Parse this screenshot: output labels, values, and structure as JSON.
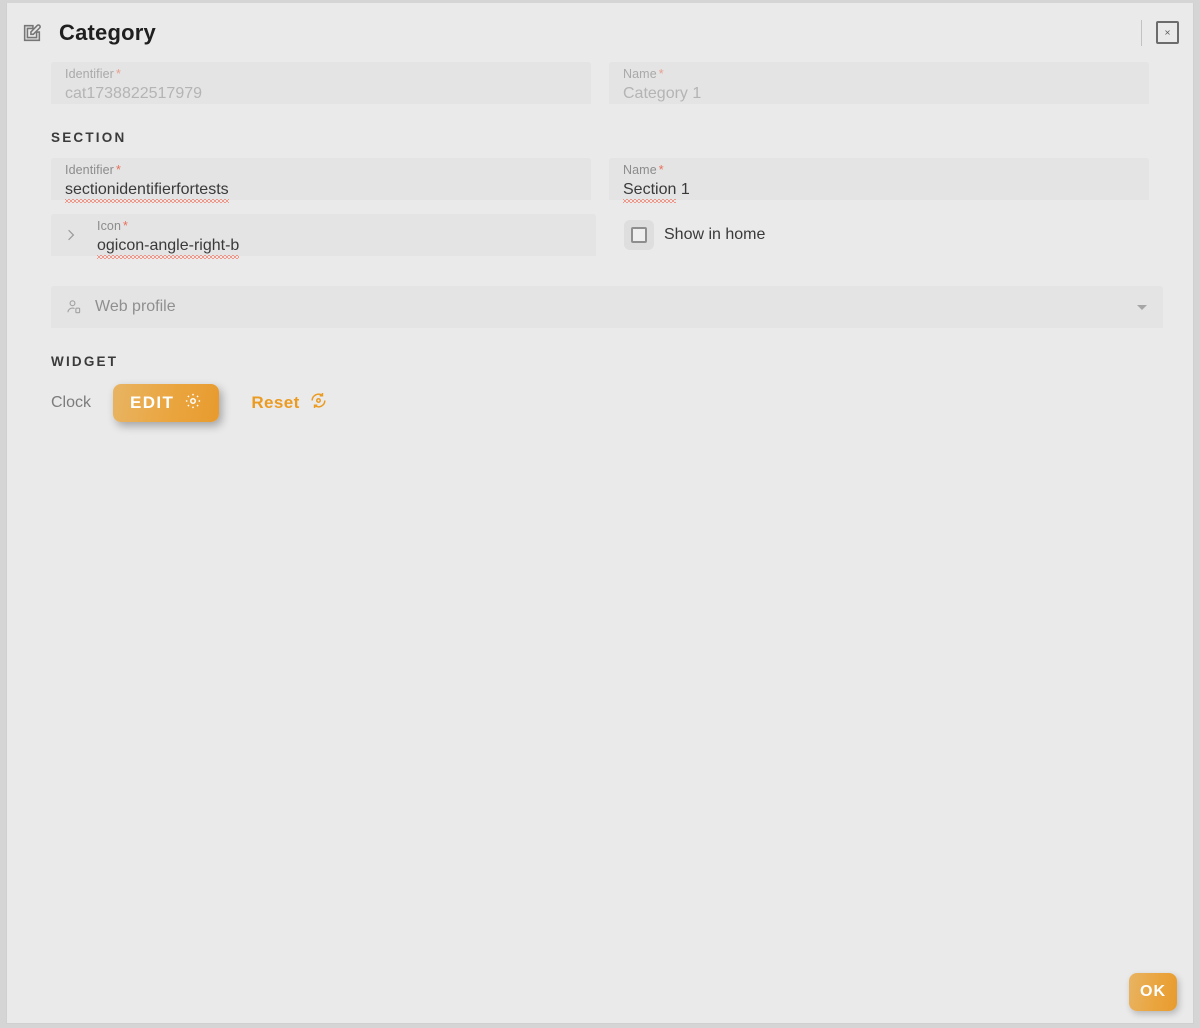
{
  "dialog": {
    "title": "Category",
    "header_icon": "edit-square-icon",
    "close_label": "×"
  },
  "category": {
    "identifier": {
      "label": "Identifier",
      "required_mark": "*",
      "value": "cat1738822517979",
      "enabled": false
    },
    "name": {
      "label": "Name",
      "required_mark": "*",
      "value": "Category 1",
      "enabled": false
    }
  },
  "section": {
    "heading": "SECTION",
    "identifier": {
      "label": "Identifier",
      "required_mark": "*",
      "value": "sectionidentifierfortests",
      "enabled": true
    },
    "name": {
      "label": "Name",
      "required_mark": "*",
      "value_misspelled": "Section",
      "value_rest": " 1",
      "enabled": true
    },
    "icon": {
      "label": "Icon",
      "required_mark": "*",
      "value": "ogicon-angle-right-b",
      "prefix_icon": "chevron-right-icon"
    },
    "show_in_home": {
      "label": "Show in home",
      "checked": false
    }
  },
  "web_profile": {
    "placeholder": "Web profile",
    "icon": "user-profile-icon"
  },
  "widget": {
    "heading": "WIDGET",
    "name": "Clock",
    "edit_label": "EDIT",
    "edit_icon": "gear-icon",
    "reset_label": "Reset",
    "reset_icon": "restore-icon"
  },
  "footer": {
    "ok_label": "OK"
  },
  "colors": {
    "accent": "#eaa53f",
    "page_background": "#eaeaea",
    "field_background": "#e4e4e4",
    "spellcheck": "#f4462b"
  }
}
